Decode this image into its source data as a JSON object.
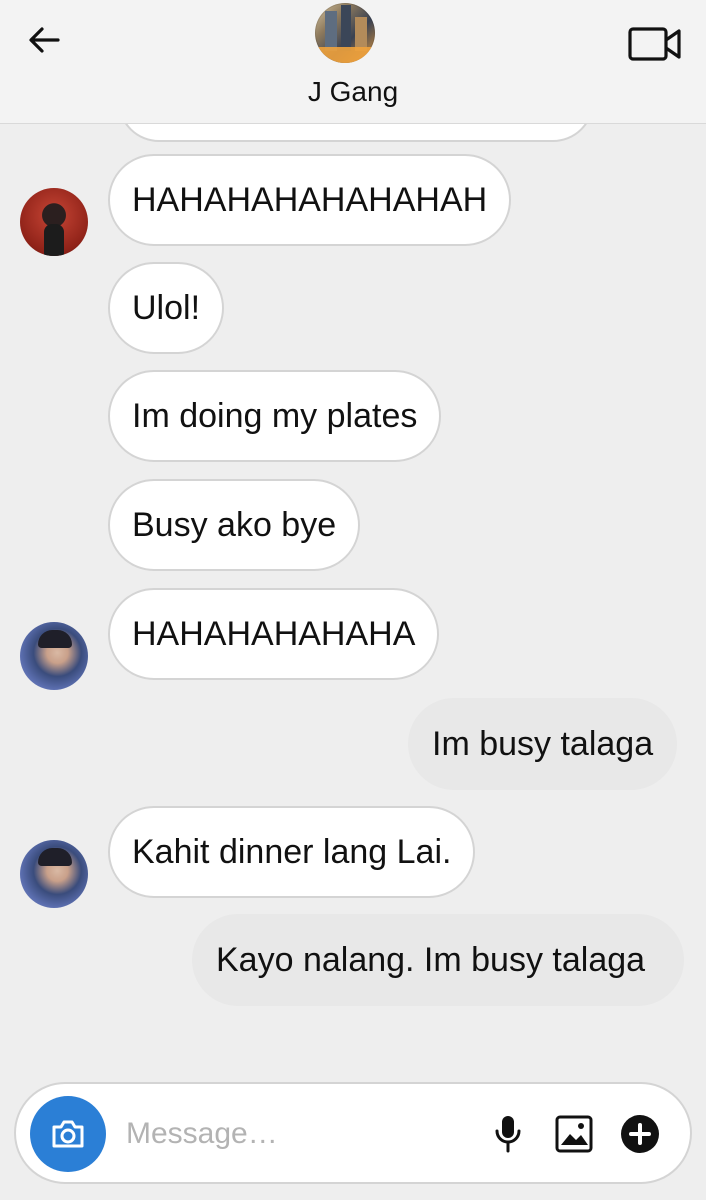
{
  "header": {
    "group_name": "J Gang",
    "back_icon": "arrow-left-icon",
    "video_icon": "video-camera-icon"
  },
  "messages": [
    {
      "text": "",
      "direction": "in",
      "partial": true
    },
    {
      "text": "HAHAHAHAHAHAHAH",
      "direction": "in",
      "avatar": "red-avatar"
    },
    {
      "text": "Ulol!",
      "direction": "in"
    },
    {
      "text": "Im doing my plates",
      "direction": "in"
    },
    {
      "text": "Busy ako bye",
      "direction": "in"
    },
    {
      "text": "HAHAHAHAHAHA",
      "direction": "in",
      "avatar": "blue-avatar"
    },
    {
      "text": "Im busy talaga",
      "direction": "out"
    },
    {
      "text": "Kahit dinner lang Lai.",
      "direction": "in",
      "avatar": "blue-avatar"
    },
    {
      "text": "Kayo nalang. Im busy talaga",
      "direction": "out"
    }
  ],
  "composer": {
    "placeholder": "Message…",
    "value": "",
    "icons": [
      "camera-icon",
      "microphone-icon",
      "image-icon",
      "plus-circle-icon"
    ]
  },
  "colors": {
    "background": "#eeeeee",
    "accent": "#2b7fd6",
    "incoming_bubble": "#ffffff",
    "outgoing_bubble": "#e8e8e8"
  }
}
